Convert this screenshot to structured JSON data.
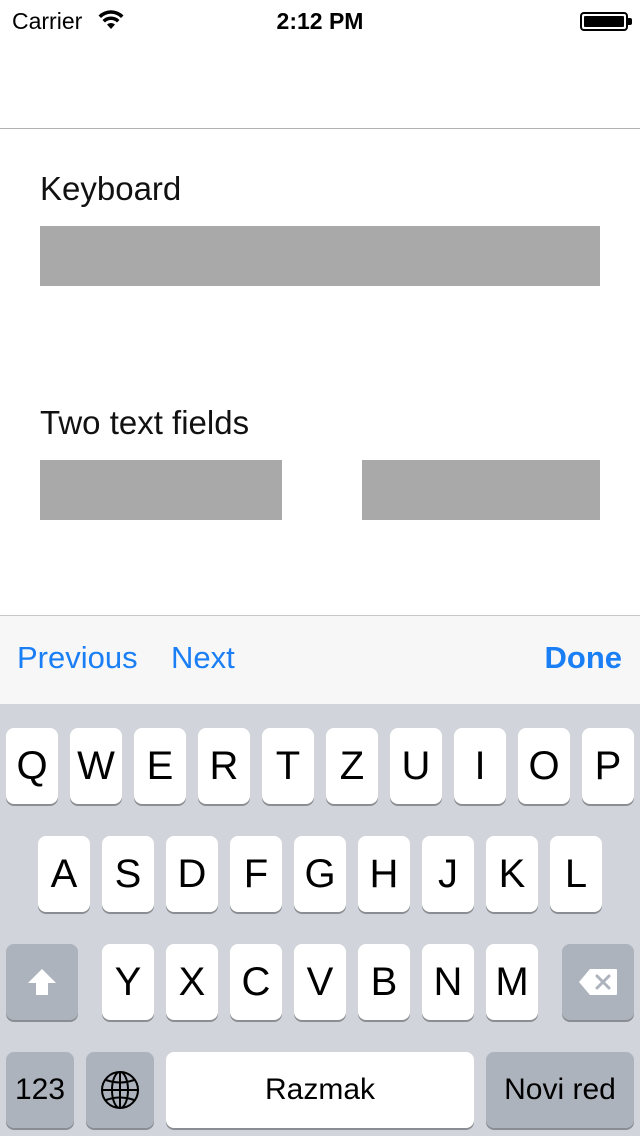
{
  "status_bar": {
    "carrier": "Carrier",
    "time": "2:12 PM",
    "wifi_icon": "wifi-icon",
    "battery_icon": "battery-icon"
  },
  "form": {
    "keyboard_label": "Keyboard",
    "two_fields_label": "Two text fields"
  },
  "toolbar": {
    "previous_label": "Previous",
    "next_label": "Next",
    "done_label": "Done",
    "accent_color": "#1a7ef5"
  },
  "keyboard": {
    "row1": [
      "Q",
      "W",
      "E",
      "R",
      "T",
      "Z",
      "U",
      "I",
      "O",
      "P"
    ],
    "row2": [
      "A",
      "S",
      "D",
      "F",
      "G",
      "H",
      "J",
      "K",
      "L"
    ],
    "row3": [
      "Y",
      "X",
      "C",
      "V",
      "B",
      "N",
      "M"
    ],
    "numbers_label": "123",
    "space_label": "Razmak",
    "return_label": "Novi red",
    "shift_icon": "shift-icon",
    "delete_icon": "delete-icon",
    "globe_icon": "globe-icon"
  }
}
